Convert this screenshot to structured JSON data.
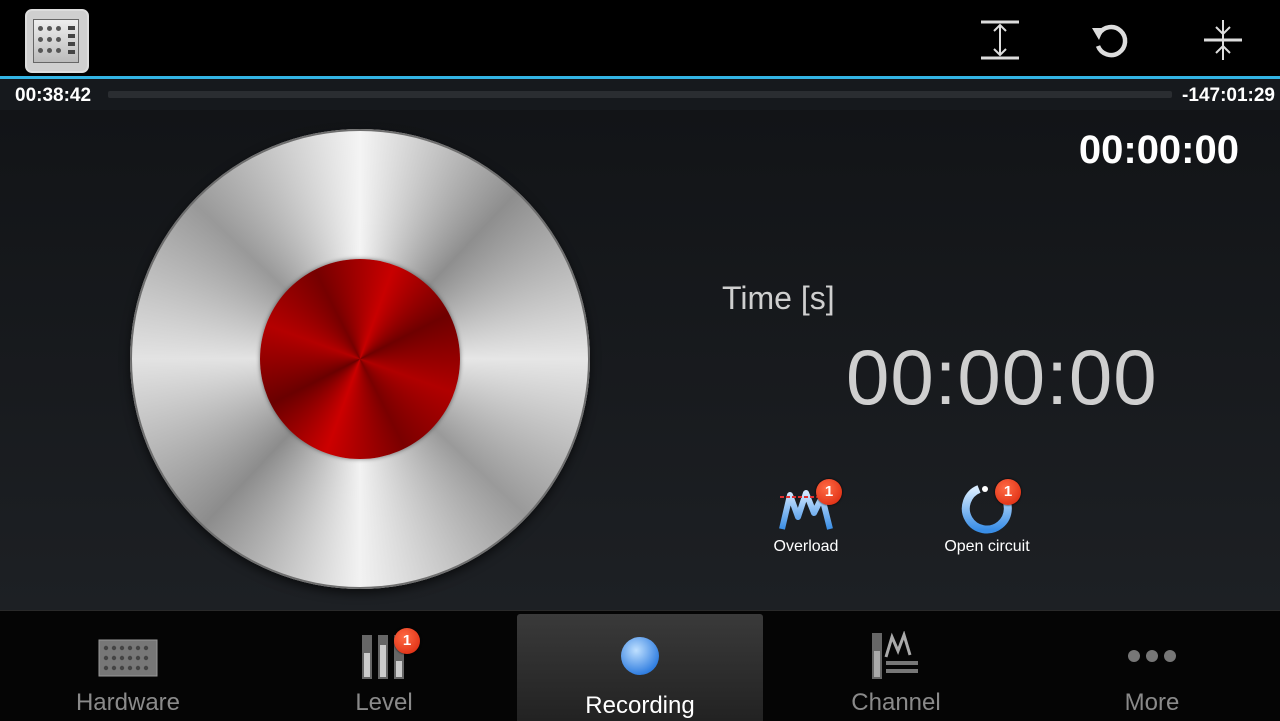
{
  "action_bar": {
    "icons": [
      "app-device-icon",
      "fit-vertical-icon",
      "reset-icon",
      "collapse-icon"
    ],
    "accent_color": "#33b5e5"
  },
  "progress": {
    "elapsed": "00:38:42",
    "remaining": "-147:01:29",
    "fraction": 0.0
  },
  "recording": {
    "elapsed_display": "00:00:00",
    "time_label": "Time [s]",
    "time_value": "00:00:00",
    "record_color": "#b00000"
  },
  "status": [
    {
      "label": "Overload",
      "badge": "1",
      "icon": "overload-icon"
    },
    {
      "label": "Open circuit",
      "badge": "1",
      "icon": "open-circuit-icon"
    }
  ],
  "nav": {
    "tabs": [
      {
        "label": "Hardware",
        "icon": "hardware-icon"
      },
      {
        "label": "Level",
        "icon": "level-icon",
        "badge": "1"
      },
      {
        "label": "Recording",
        "icon": "recording-icon",
        "active": true
      },
      {
        "label": "Channel",
        "icon": "channel-icon"
      },
      {
        "label": "More",
        "icon": "more-icon"
      }
    ]
  }
}
